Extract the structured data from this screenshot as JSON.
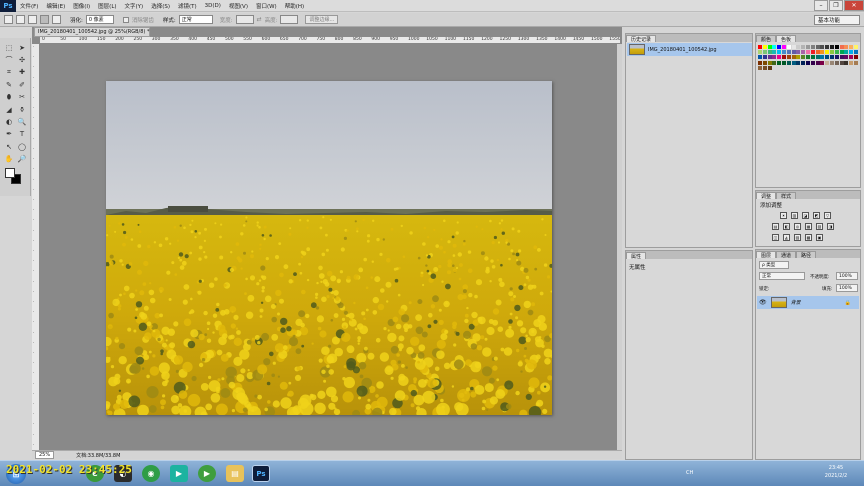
{
  "menubar": {
    "logo": "Ps",
    "items": [
      "文件(F)",
      "编辑(E)",
      "图像(I)",
      "图层(L)",
      "文字(Y)",
      "选择(S)",
      "滤镜(T)",
      "3D(D)",
      "视图(V)",
      "窗口(W)",
      "帮助(H)"
    ]
  },
  "options": {
    "feather_label": "羽化:",
    "feather_value": "0 像素",
    "antialias_label": "消除锯齿",
    "style_label": "样式:",
    "style_value": "正常",
    "width_label": "宽度:",
    "height_label": "高度:",
    "refine_edge": "调整边缘...",
    "workspace": "基本功能"
  },
  "document": {
    "tab_title": "IMG_20180401_100542.jpg @ 25%(RGB/8) *",
    "ruler_labels": [
      "0",
      "50",
      "100",
      "150",
      "200",
      "250",
      "300",
      "350",
      "400",
      "450",
      "500",
      "550",
      "600",
      "650",
      "700",
      "750",
      "800",
      "850",
      "900",
      "950",
      "1000",
      "1050",
      "1100",
      "1150",
      "1200",
      "1250",
      "1300",
      "1350",
      "1400",
      "1450",
      "1500",
      "1550"
    ]
  },
  "statusbar": {
    "zoom": "25%",
    "doc_info": "文档:33.8M/33.8M"
  },
  "history": {
    "tab_history": "历史记录",
    "item": "IMG_20180401_100542.jpg"
  },
  "properties": {
    "tab": "属性",
    "content": "无属性"
  },
  "swatches": {
    "tab_color": "颜色",
    "tab_swatches": "色板"
  },
  "adjustments": {
    "tab_adjust": "调整",
    "tab_style": "样式",
    "title": "添加调整"
  },
  "layers": {
    "tab_layers": "图层",
    "tab_channels": "通道",
    "tab_paths": "路径",
    "kind": "ρ 类型",
    "blend": "正常",
    "opacity_label": "不透明度:",
    "opacity_value": "100%",
    "lock_label": "锁定:",
    "fill_label": "填充:",
    "fill_value": "100%",
    "layer_name": "背景"
  },
  "taskbar": {
    "time": "23:45",
    "date": "2021/2/2",
    "ime": "CH"
  },
  "overlay": {
    "timestamp": "2021-02-02 23:45:25"
  },
  "colors": {
    "history_selected": "#a6c6ec",
    "flower_yellow": "#e3c20e",
    "sky": "#c4c9d2"
  }
}
